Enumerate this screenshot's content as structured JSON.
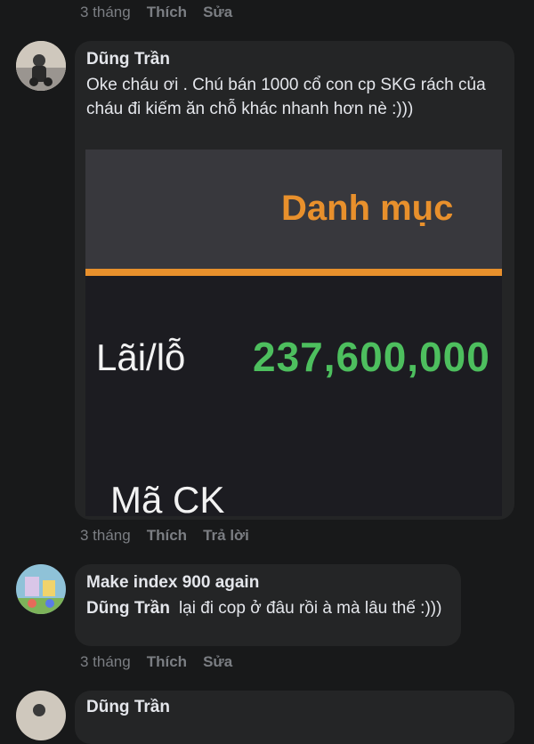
{
  "top_meta": {
    "time": "3 tháng",
    "like": "Thích",
    "edit": "Sửa"
  },
  "comment1": {
    "author": "Dũng Trần",
    "text": "Oke cháu ơi . Chú bán 1000 cổ con cp SKG rách của cháu đi kiếm ăn chỗ khác nhanh hơn nè :)))",
    "attachment": {
      "title": "Danh mục",
      "row1_label": "Lãi/lỗ",
      "row1_value": "237,600,000",
      "row2_label": "Mã CK"
    },
    "meta": {
      "time": "3 tháng",
      "like": "Thích",
      "reply": "Trả lời"
    }
  },
  "comment2": {
    "author": "Make index 900 again",
    "mention": "Dũng Trần",
    "text": "lại đi cop ở đâu rồi à mà lâu thế :)))",
    "meta": {
      "time": "3 tháng",
      "like": "Thích",
      "edit": "Sửa"
    }
  },
  "comment3": {
    "author": "Dũng Trần"
  },
  "colors": {
    "background": "#18191a",
    "bubble": "#242526",
    "accent_orange": "#e8902c",
    "profit_green": "#4dbf5e"
  }
}
